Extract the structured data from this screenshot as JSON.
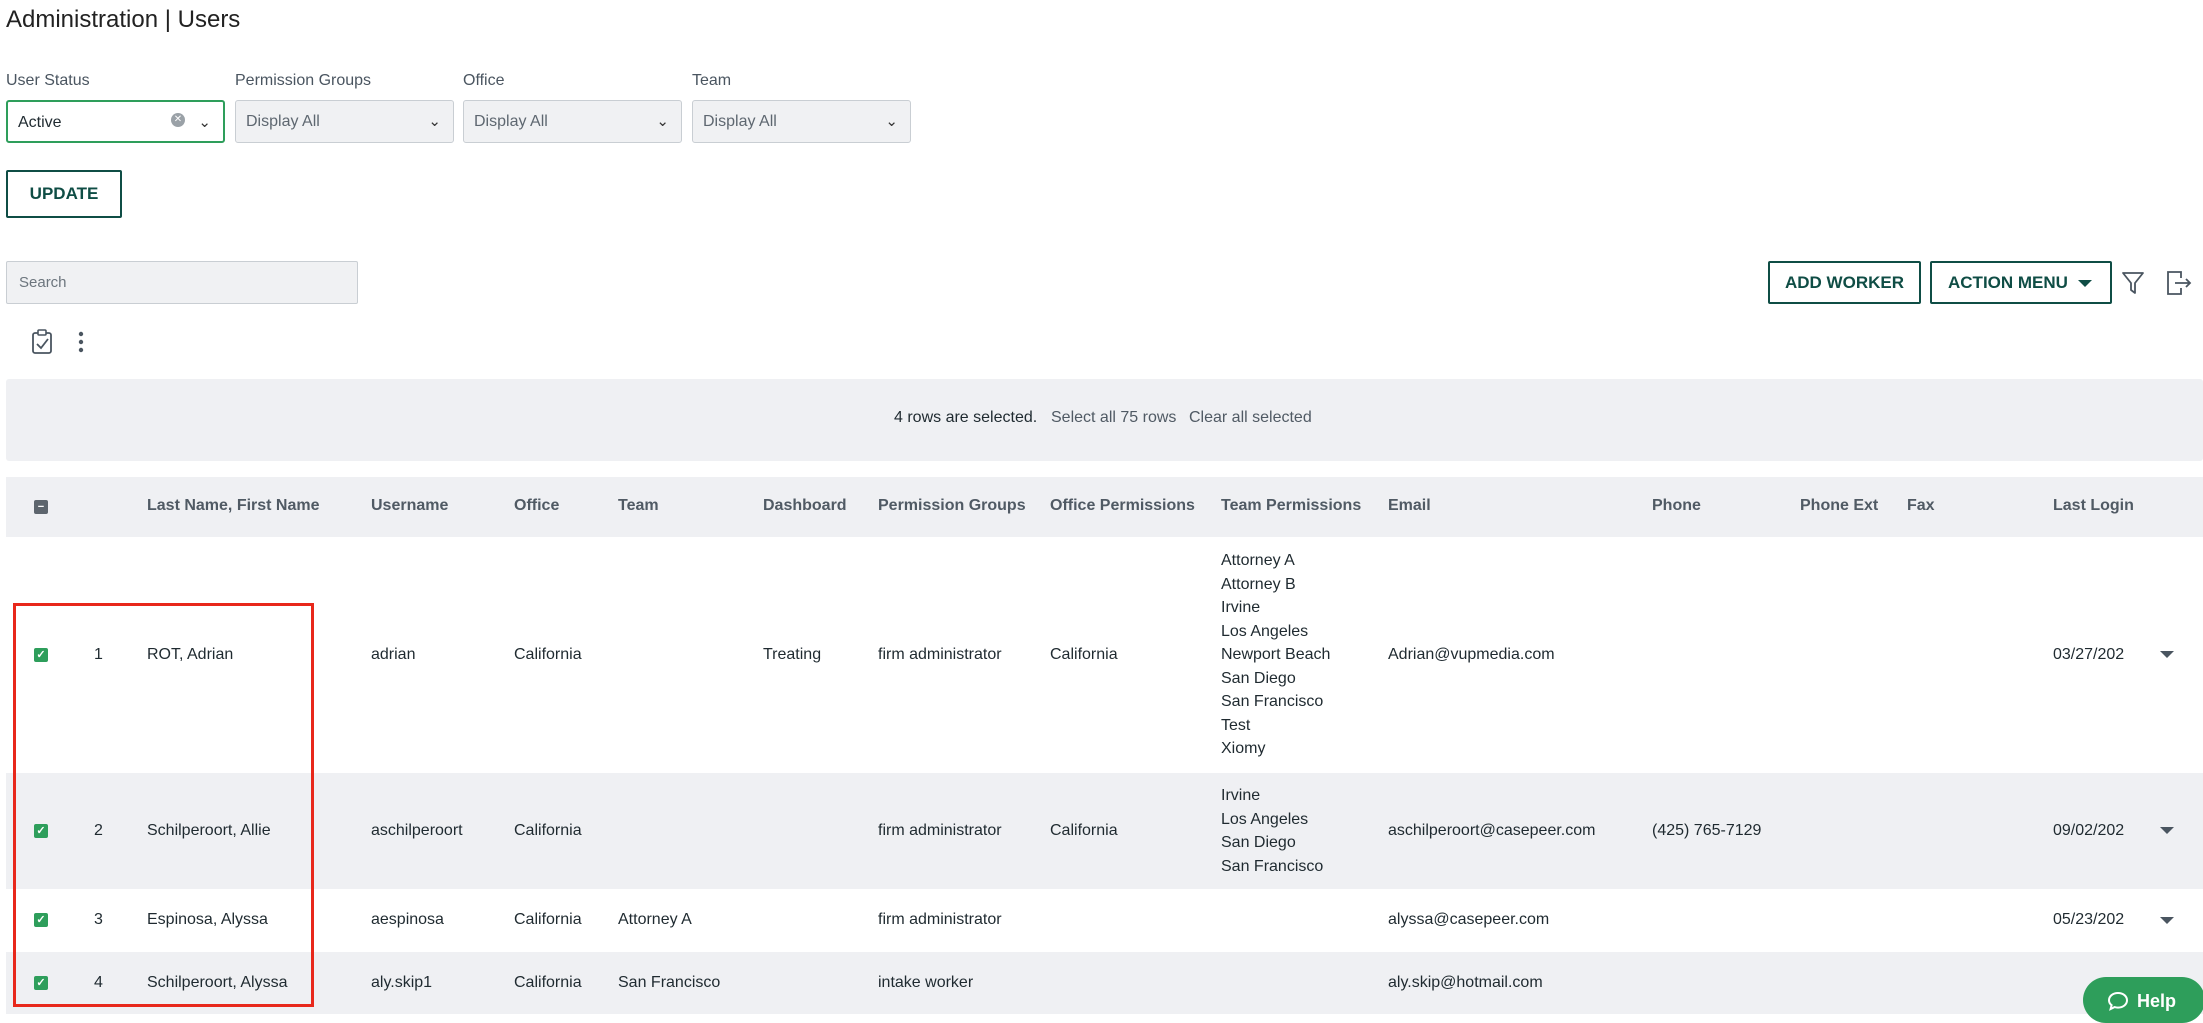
{
  "page": {
    "title": "Administration | Users"
  },
  "filters": [
    {
      "label": "User Status",
      "value": "Active",
      "active": true
    },
    {
      "label": "Permission Groups",
      "value": "Display All",
      "active": false
    },
    {
      "label": "Office",
      "value": "Display All",
      "active": false
    },
    {
      "label": "Team",
      "value": "Display All",
      "active": false
    }
  ],
  "update_label": "UPDATE",
  "search": {
    "placeholder": "Search",
    "value": ""
  },
  "toolbar": {
    "add_worker": "ADD WORKER",
    "action_menu": "ACTION MENU"
  },
  "selection": {
    "count_text": "4 rows are selected.",
    "select_all": "Select all 75 rows",
    "clear_all": "Clear all selected"
  },
  "columns": [
    "Last Name, First Name",
    "Username",
    "Office",
    "Team",
    "Dashboard",
    "Permission Groups",
    "Office Permissions",
    "Team Permissions",
    "Email",
    "Phone",
    "Phone Ext",
    "Fax",
    "Last Login"
  ],
  "rows": [
    {
      "num": "1",
      "name": "ROT, Adrian",
      "username": "adrian",
      "office": "California",
      "team": "",
      "dashboard": "Treating",
      "permission_groups": "firm administrator",
      "office_permissions": "California",
      "team_permissions": "Attorney A\nAttorney B\nIrvine\nLos Angeles\nNewport Beach\nSan Diego\nSan Francisco\nTest\nXiomy",
      "email": "Adrian@vupmedia.com",
      "phone": "",
      "phone_ext": "",
      "fax": "",
      "last_login": "03/27/202",
      "checked": true
    },
    {
      "num": "2",
      "name": "Schilperoort, Allie",
      "username": "aschilperoort",
      "office": "California",
      "team": "",
      "dashboard": "",
      "permission_groups": "firm administrator",
      "office_permissions": "California",
      "team_permissions": "Irvine\nLos Angeles\nSan Diego\nSan Francisco",
      "email": "aschilperoort@casepeer.com",
      "phone": "(425) 765-7129",
      "phone_ext": "",
      "fax": "",
      "last_login": "09/02/202",
      "checked": true
    },
    {
      "num": "3",
      "name": "Espinosa, Alyssa",
      "username": "aespinosa",
      "office": "California",
      "team": "Attorney A",
      "dashboard": "",
      "permission_groups": "firm administrator",
      "office_permissions": "",
      "team_permissions": "",
      "email": "alyssa@casepeer.com",
      "phone": "",
      "phone_ext": "",
      "fax": "",
      "last_login": "05/23/202",
      "checked": true
    },
    {
      "num": "4",
      "name": "Schilperoort, Alyssa",
      "username": "aly.skip1",
      "office": "California",
      "team": "San Francisco",
      "dashboard": "",
      "permission_groups": "intake worker",
      "office_permissions": "",
      "team_permissions": "",
      "email": "aly.skip@hotmail.com",
      "phone": "",
      "phone_ext": "",
      "fax": "",
      "last_login": "",
      "checked": true
    }
  ],
  "help_label": "Help",
  "colors": {
    "accent": "#0f4d45",
    "check": "#2e9e5b",
    "highlight": "#e8281b"
  }
}
